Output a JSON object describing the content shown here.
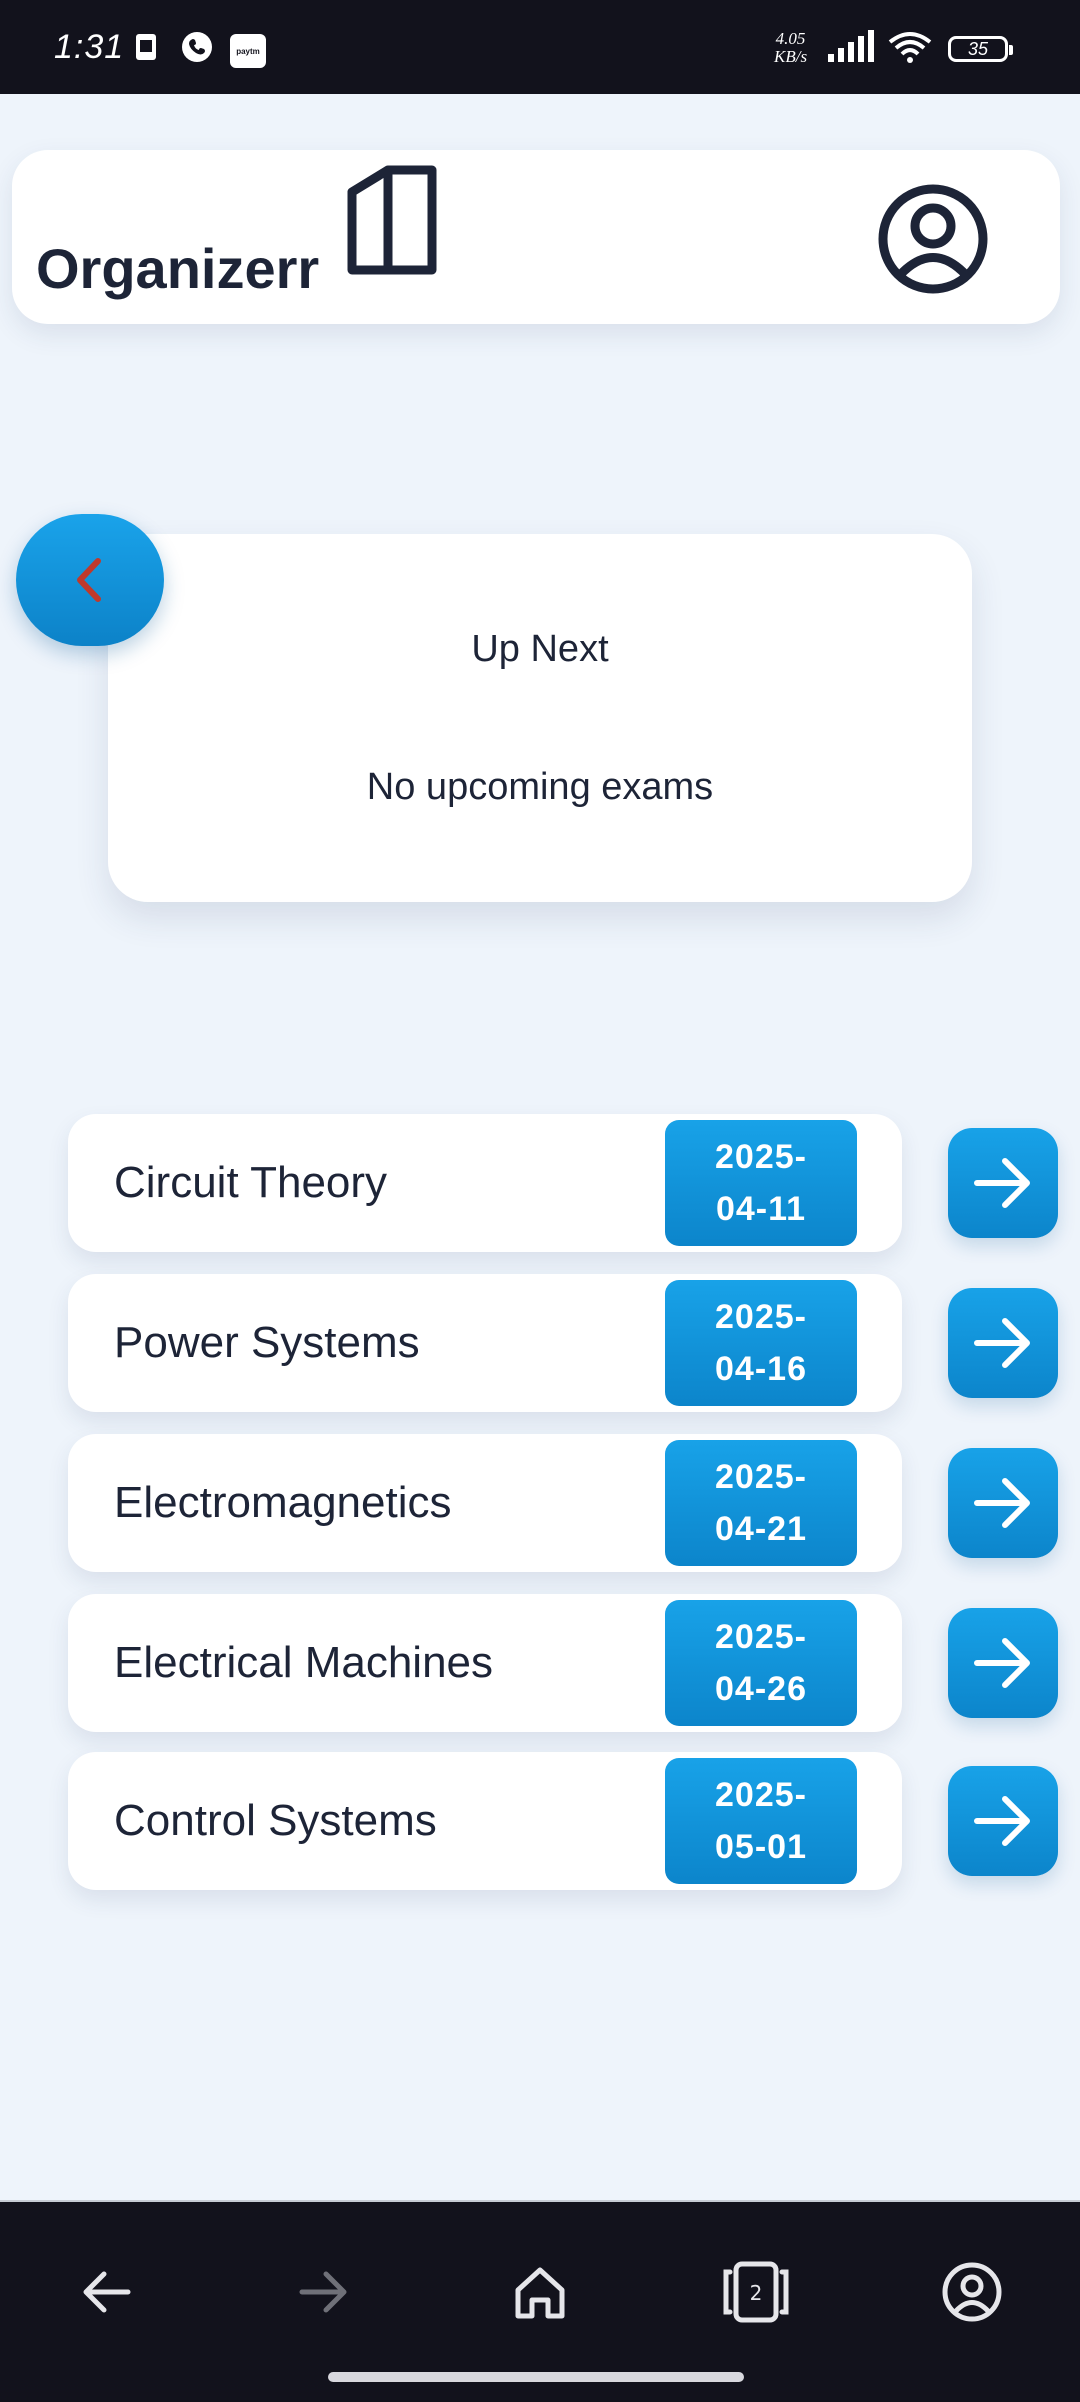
{
  "status_bar": {
    "time": "1:31",
    "network_speed": [
      "4.05",
      "KB/s"
    ],
    "battery": "35",
    "notification_icons": [
      "sim-card-icon",
      "phone-icon",
      "paytm-icon"
    ],
    "paytm_label": "paytm"
  },
  "header": {
    "app_title": "Organizerr",
    "logo_icon": "book-icon",
    "profile_icon": "user-circle-icon"
  },
  "up_next": {
    "title": "Up Next",
    "empty_message": "No upcoming exams",
    "back_icon": "chevron-left-icon"
  },
  "exams": [
    {
      "name": "Circuit Theory",
      "date_top": "2025-",
      "date_bottom": "04-11"
    },
    {
      "name": "Power Systems",
      "date_top": "2025-",
      "date_bottom": "04-16"
    },
    {
      "name": "Electromagnetics",
      "date_top": "2025-",
      "date_bottom": "04-21"
    },
    {
      "name": "Electrical Machines",
      "date_top": "2025-",
      "date_bottom": "04-26"
    },
    {
      "name": "Control Systems",
      "date_top": "2025-",
      "date_bottom": "05-01"
    }
  ],
  "bottom_nav": {
    "items": [
      "back-arrow-icon",
      "forward-arrow-icon",
      "home-icon",
      "tabs-icon",
      "account-icon"
    ],
    "tab_count": "2"
  },
  "colors": {
    "primary": "#0e8fd6",
    "text": "#1d2437",
    "background": "#eef4fb",
    "accent_chevron": "#c0392b"
  }
}
